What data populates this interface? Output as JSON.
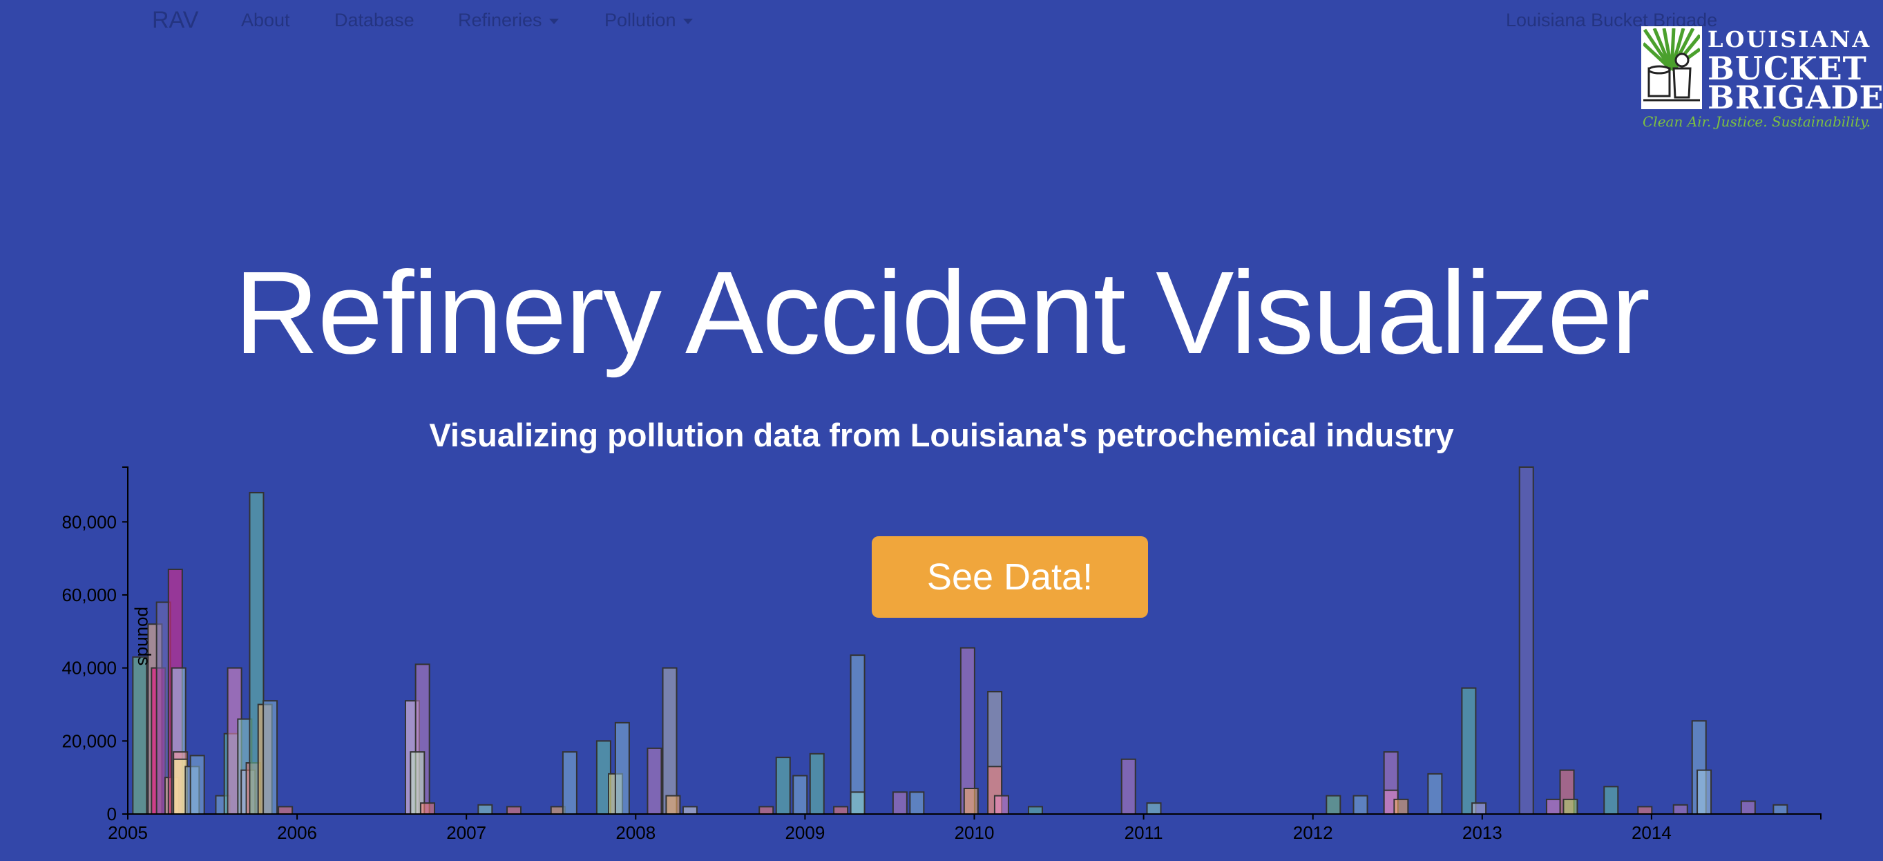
{
  "nav": {
    "brand": "RAV",
    "links": [
      "About",
      "Database",
      "Refineries",
      "Pollution"
    ],
    "right_link": "Louisiana Bucket Brigade"
  },
  "logo": {
    "line1": "LOUISIANA",
    "line2": "BUCKET",
    "line3": "BRIGADE",
    "tagline": "Clean Air. Justice. Sustainability."
  },
  "hero": {
    "title": "Refinery Accident Visualizer",
    "subtitle": "Visualizing pollution data from Louisiana's petrochemical industry",
    "cta_label": "See Data!"
  },
  "chart_data": {
    "type": "bar",
    "title": "",
    "xlabel": "",
    "ylabel": "pounds",
    "xlim": [
      2005.0,
      2015.0
    ],
    "ylim": [
      0,
      95000
    ],
    "x_ticks": [
      "2005",
      "2006",
      "2007",
      "2008",
      "2009",
      "2010",
      "2011",
      "2012",
      "2013",
      "2014"
    ],
    "y_ticks": [
      "0",
      "20,000",
      "40,000",
      "60,000",
      "80,000"
    ],
    "y_tick_values": [
      0,
      20000,
      40000,
      60000,
      80000
    ],
    "grid": false,
    "legend": "none",
    "bars": [
      {
        "x": 2005.03,
        "y": 43000,
        "color": "#7fc97f"
      },
      {
        "x": 2005.12,
        "y": 52000,
        "color": "#fdc086"
      },
      {
        "x": 2005.14,
        "y": 40000,
        "color": "#f0027f"
      },
      {
        "x": 2005.17,
        "y": 58000,
        "color": "#7570b3"
      },
      {
        "x": 2005.22,
        "y": 10000,
        "color": "#fdc086"
      },
      {
        "x": 2005.24,
        "y": 67000,
        "color": "#e7298a"
      },
      {
        "x": 2005.26,
        "y": 40000,
        "color": "#a6cee3"
      },
      {
        "x": 2005.27,
        "y": 17000,
        "color": "#fb9a99"
      },
      {
        "x": 2005.27,
        "y": 15000,
        "color": "#ffff99"
      },
      {
        "x": 2005.34,
        "y": 13000,
        "color": "#a6cee3"
      },
      {
        "x": 2005.37,
        "y": 16000,
        "color": "#80b1d3"
      },
      {
        "x": 2005.52,
        "y": 5000,
        "color": "#80b1d3"
      },
      {
        "x": 2005.57,
        "y": 22000,
        "color": "#66c2a5"
      },
      {
        "x": 2005.59,
        "y": 40000,
        "color": "#e78ac3"
      },
      {
        "x": 2005.65,
        "y": 26000,
        "color": "#8dd3c7"
      },
      {
        "x": 2005.67,
        "y": 12000,
        "color": "#bebada"
      },
      {
        "x": 2005.7,
        "y": 14000,
        "color": "#fb8072"
      },
      {
        "x": 2005.72,
        "y": 88000,
        "color": "#66c2a5"
      },
      {
        "x": 2005.77,
        "y": 30000,
        "color": "#fdb462"
      },
      {
        "x": 2005.8,
        "y": 31000,
        "color": "#80b1d3"
      },
      {
        "x": 2005.89,
        "y": 2000,
        "color": "#fb8072"
      },
      {
        "x": 2006.64,
        "y": 31000,
        "color": "#fccde5"
      },
      {
        "x": 2006.7,
        "y": 41000,
        "color": "#bc80bd"
      },
      {
        "x": 2006.67,
        "y": 17000,
        "color": "#ccebc5"
      },
      {
        "x": 2006.73,
        "y": 3000,
        "color": "#fb8072"
      },
      {
        "x": 2007.07,
        "y": 2500,
        "color": "#8dd3c7"
      },
      {
        "x": 2007.24,
        "y": 2000,
        "color": "#fb8072"
      },
      {
        "x": 2007.5,
        "y": 2000,
        "color": "#fdb462"
      },
      {
        "x": 2007.57,
        "y": 17000,
        "color": "#80b1d3"
      },
      {
        "x": 2007.77,
        "y": 20000,
        "color": "#66c2a5"
      },
      {
        "x": 2007.84,
        "y": 11000,
        "color": "#ffff99"
      },
      {
        "x": 2007.88,
        "y": 25000,
        "color": "#80b1d3"
      },
      {
        "x": 2008.07,
        "y": 18000,
        "color": "#bc80bd"
      },
      {
        "x": 2008.16,
        "y": 40000,
        "color": "#b3b3b3"
      },
      {
        "x": 2008.18,
        "y": 5000,
        "color": "#fdb462"
      },
      {
        "x": 2008.28,
        "y": 2000,
        "color": "#d9d9d9"
      },
      {
        "x": 2008.73,
        "y": 2000,
        "color": "#fb8072"
      },
      {
        "x": 2008.83,
        "y": 15500,
        "color": "#66c2a5"
      },
      {
        "x": 2008.93,
        "y": 10500,
        "color": "#80b1d3"
      },
      {
        "x": 2009.03,
        "y": 16500,
        "color": "#66c2a5"
      },
      {
        "x": 2009.17,
        "y": 2000,
        "color": "#fb8072"
      },
      {
        "x": 2009.27,
        "y": 43500,
        "color": "#80b1d3"
      },
      {
        "x": 2009.27,
        "y": 6000,
        "color": "#8dd3c7"
      },
      {
        "x": 2009.52,
        "y": 6000,
        "color": "#bc80bd"
      },
      {
        "x": 2009.62,
        "y": 6000,
        "color": "#80b1d3"
      },
      {
        "x": 2009.92,
        "y": 45500,
        "color": "#bc80bd"
      },
      {
        "x": 2009.94,
        "y": 7000,
        "color": "#fdb462"
      },
      {
        "x": 2010.08,
        "y": 33500,
        "color": "#b3b3b3"
      },
      {
        "x": 2010.08,
        "y": 13000,
        "color": "#fb8072"
      },
      {
        "x": 2010.12,
        "y": 5000,
        "color": "#e78ac3"
      },
      {
        "x": 2010.32,
        "y": 2000,
        "color": "#66c2a5"
      },
      {
        "x": 2010.87,
        "y": 15000,
        "color": "#bc80bd"
      },
      {
        "x": 2011.02,
        "y": 3000,
        "color": "#8dd3c7"
      },
      {
        "x": 2012.08,
        "y": 5000,
        "color": "#7fc97f"
      },
      {
        "x": 2012.24,
        "y": 5000,
        "color": "#80b1d3"
      },
      {
        "x": 2012.42,
        "y": 17000,
        "color": "#bc80bd"
      },
      {
        "x": 2012.42,
        "y": 6500,
        "color": "#e78ac3"
      },
      {
        "x": 2012.48,
        "y": 4000,
        "color": "#fdb462"
      },
      {
        "x": 2012.68,
        "y": 11000,
        "color": "#80b1d3"
      },
      {
        "x": 2012.88,
        "y": 34500,
        "color": "#66c2a5"
      },
      {
        "x": 2012.94,
        "y": 3000,
        "color": "#bebada"
      },
      {
        "x": 2013.22,
        "y": 95000,
        "color": "#7570b3"
      },
      {
        "x": 2013.38,
        "y": 4000,
        "color": "#e78ac3"
      },
      {
        "x": 2013.46,
        "y": 12000,
        "color": "#fb8072"
      },
      {
        "x": 2013.48,
        "y": 4000,
        "color": "#b3de69"
      },
      {
        "x": 2013.72,
        "y": 7500,
        "color": "#66c2a5"
      },
      {
        "x": 2013.92,
        "y": 2000,
        "color": "#fb8072"
      },
      {
        "x": 2014.13,
        "y": 2500,
        "color": "#bc80bd"
      },
      {
        "x": 2014.24,
        "y": 25500,
        "color": "#80b1d3"
      },
      {
        "x": 2014.27,
        "y": 12000,
        "color": "#a6cee3"
      },
      {
        "x": 2014.53,
        "y": 3500,
        "color": "#bc80bd"
      },
      {
        "x": 2014.72,
        "y": 2500,
        "color": "#80b1d3"
      }
    ]
  }
}
